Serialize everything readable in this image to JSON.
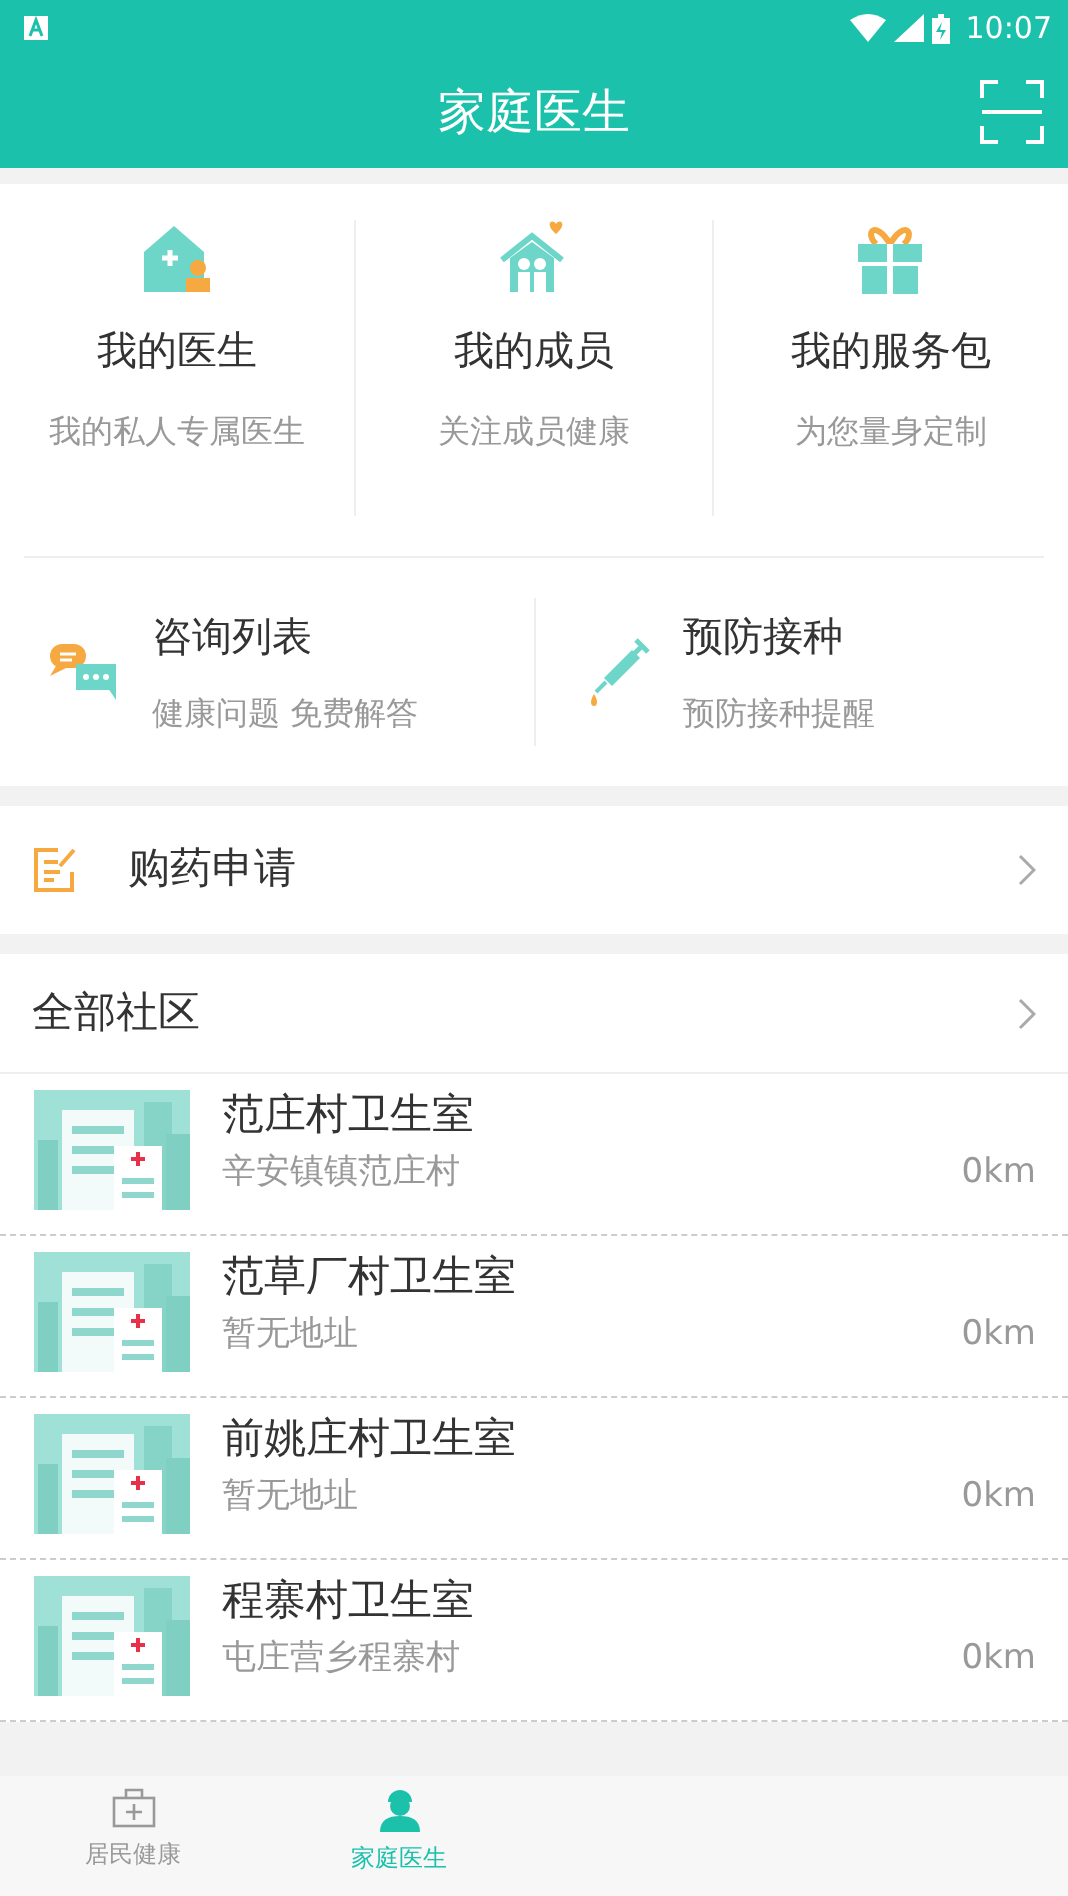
{
  "status_bar": {
    "time": "10:07"
  },
  "app_bar": {
    "title": "家庭医生"
  },
  "services": [
    {
      "kind": "doctor",
      "title": "我的医生",
      "subtitle": "我的私人专属医生"
    },
    {
      "kind": "members",
      "title": "我的成员",
      "subtitle": "关注成员健康"
    },
    {
      "kind": "package",
      "title": "我的服务包",
      "subtitle": "为您量身定制"
    }
  ],
  "shortcuts": [
    {
      "kind": "chat",
      "title": "咨询列表",
      "subtitle": "健康问题 免费解答"
    },
    {
      "kind": "vaccine",
      "title": "预防接种",
      "subtitle": "预防接种提醒"
    }
  ],
  "medicine_row": {
    "label": "购药申请"
  },
  "community_header": {
    "label": "全部社区"
  },
  "clinics": [
    {
      "name": "范庄村卫生室",
      "address": "辛安镇镇范庄村",
      "distance": "0km"
    },
    {
      "name": "范草厂村卫生室",
      "address": "暂无地址",
      "distance": "0km"
    },
    {
      "name": "前姚庄村卫生室",
      "address": "暂无地址",
      "distance": "0km"
    },
    {
      "name": "程寨村卫生室",
      "address": "屯庄营乡程寨村",
      "distance": "0km"
    }
  ],
  "bottom_nav": [
    {
      "kind": "health",
      "label": "居民健康",
      "selected": false
    },
    {
      "kind": "doctor",
      "label": "家庭医生",
      "selected": true
    }
  ]
}
